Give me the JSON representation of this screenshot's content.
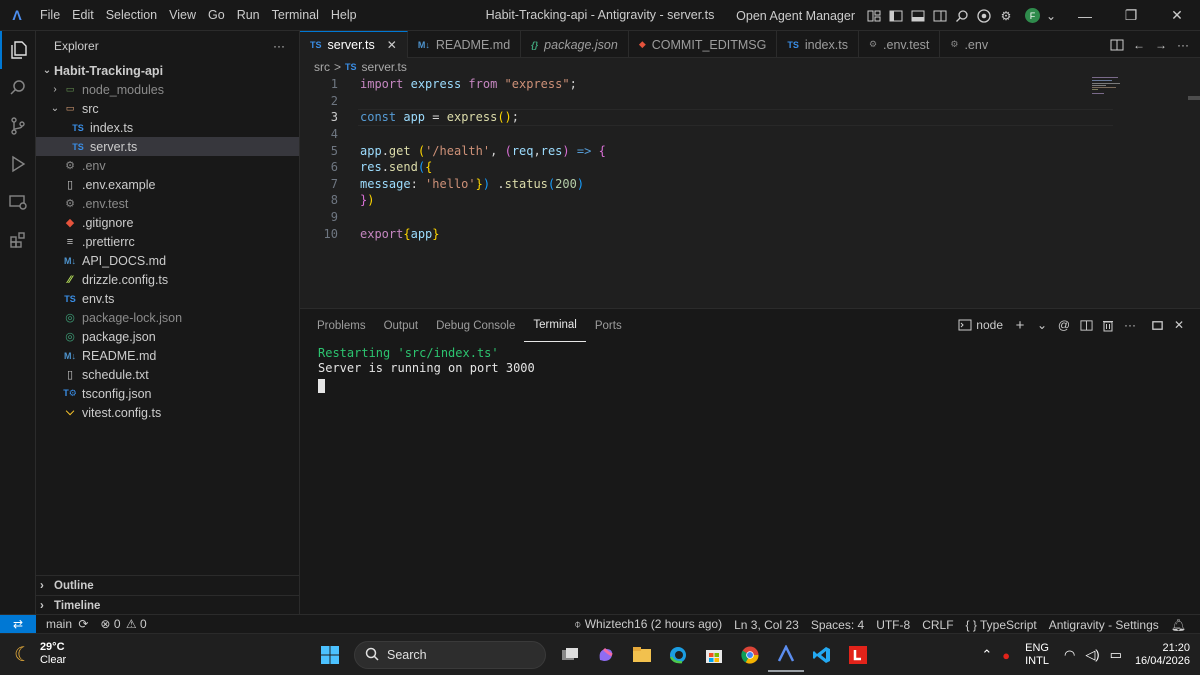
{
  "app": {
    "menu": [
      "File",
      "Edit",
      "Selection",
      "View",
      "Go",
      "Run",
      "Terminal",
      "Help"
    ],
    "window_title": "Habit-Tracking-api - Antigravity - server.ts",
    "agent_manager": "Open Agent Manager",
    "avatar_letter": "F",
    "accent": "#0078d4"
  },
  "sidebar": {
    "title": "Explorer",
    "more": "···",
    "root": "Habit-Tracking-api",
    "items": [
      {
        "label": "node_modules",
        "icon": "folder-icon",
        "type": "folder",
        "collapsed": true
      },
      {
        "label": "src",
        "icon": "folder-icon",
        "type": "folder",
        "collapsed": false
      },
      {
        "label": "index.ts",
        "icon": "ts-file-icon",
        "type": "file",
        "badge": "TS"
      },
      {
        "label": "server.ts",
        "icon": "ts-file-icon",
        "type": "file",
        "badge": "TS",
        "selected": true
      },
      {
        "label": ".env",
        "icon": "gear-icon",
        "type": "file"
      },
      {
        "label": ".env.example",
        "icon": "file-icon",
        "type": "file"
      },
      {
        "label": ".env.test",
        "icon": "gear-icon",
        "type": "file"
      },
      {
        "label": ".gitignore",
        "icon": "git-icon",
        "type": "file"
      },
      {
        "label": ".prettierrc",
        "icon": "prettier-icon",
        "type": "file"
      },
      {
        "label": "API_DOCS.md",
        "icon": "markdown-icon",
        "type": "file",
        "badge": "M↓"
      },
      {
        "label": "drizzle.config.ts",
        "icon": "drizzle-icon",
        "type": "file"
      },
      {
        "label": "env.ts",
        "icon": "ts-file-icon",
        "type": "file",
        "badge": "TS"
      },
      {
        "label": "package-lock.json",
        "icon": "npm-icon",
        "type": "file",
        "dim": true
      },
      {
        "label": "package.json",
        "icon": "npm-icon",
        "type": "file"
      },
      {
        "label": "README.md",
        "icon": "markdown-icon",
        "type": "file",
        "badge": "M↓"
      },
      {
        "label": "schedule.txt",
        "icon": "file-icon",
        "type": "file"
      },
      {
        "label": "tsconfig.json",
        "icon": "tsconfig-icon",
        "type": "file"
      },
      {
        "label": "vitest.config.ts",
        "icon": "vitest-icon",
        "type": "file"
      }
    ],
    "outline": "Outline",
    "timeline": "Timeline"
  },
  "tabs": [
    {
      "label": "server.ts",
      "badge": "TS",
      "active": true
    },
    {
      "label": "README.md",
      "badge": "M↓"
    },
    {
      "label": "package.json",
      "badge": "{}"
    },
    {
      "label": "COMMIT_EDITMSG",
      "badge": "◆"
    },
    {
      "label": "index.ts",
      "badge": "TS"
    },
    {
      "label": ".env.test",
      "badge": "⚙"
    },
    {
      "label": ".env",
      "badge": "⚙"
    }
  ],
  "breadcrumb": {
    "folder": "src",
    "sep": ">",
    "badge": "TS",
    "file": "server.ts"
  },
  "code": {
    "line_numbers": [
      "1",
      "2",
      "3",
      "4",
      "5",
      "6",
      "7",
      "8",
      "9",
      "10"
    ],
    "current_line": 3
  },
  "panel": {
    "tabs": [
      "Problems",
      "Output",
      "Debug Console",
      "Terminal",
      "Ports"
    ],
    "active_tab": "Terminal",
    "shell": "node",
    "terminal_lines": [
      "Restarting 'src/index.ts'",
      "Server is running on port 3000"
    ]
  },
  "status": {
    "branch": "main",
    "errors": "0",
    "warnings": "0",
    "blame": "Whiztech16 (2 hours ago)",
    "position": "Ln 3, Col 23",
    "spaces": "Spaces: 4",
    "encoding": "UTF-8",
    "eol": "CRLF",
    "language": "TypeScript",
    "settings": "Antigravity - Settings"
  },
  "taskbar": {
    "temperature": "29°C",
    "condition": "Clear",
    "search_placeholder": "Search",
    "lang_1": "ENG",
    "lang_2": "INTL",
    "time": "21:20",
    "date": "16/04/2026"
  }
}
